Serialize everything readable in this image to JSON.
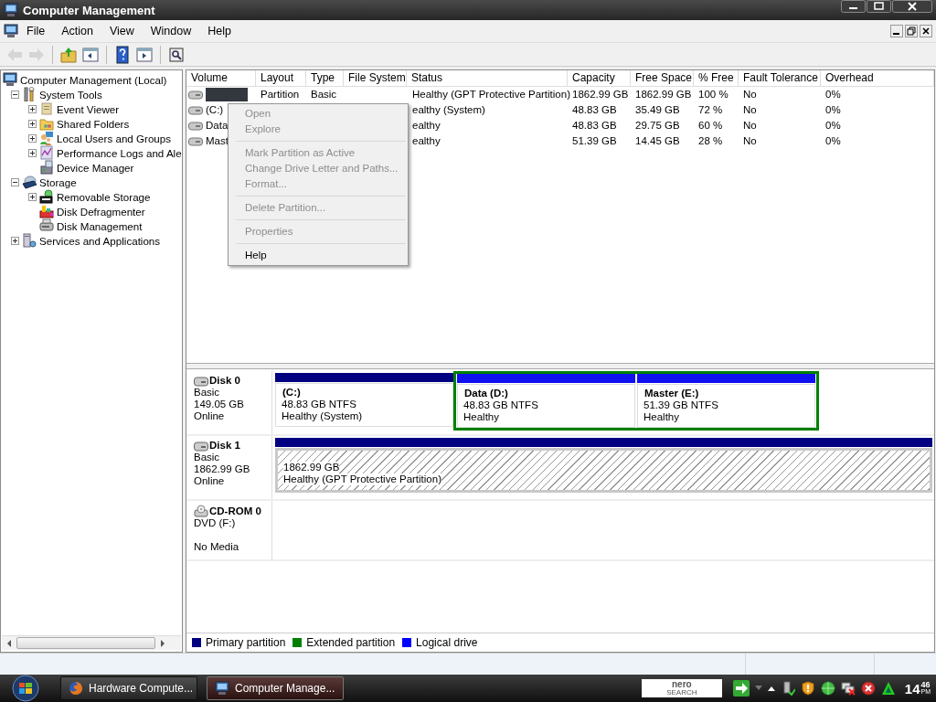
{
  "window": {
    "title": "Computer Management"
  },
  "menu": [
    "File",
    "Action",
    "View",
    "Window",
    "Help"
  ],
  "toolbar": [
    {
      "kind": "back",
      "disabled": true
    },
    {
      "kind": "forward",
      "disabled": true
    },
    {
      "kind": "sep"
    },
    {
      "kind": "up",
      "disabled": false
    },
    {
      "kind": "tree",
      "disabled": false
    },
    {
      "kind": "sep"
    },
    {
      "kind": "help",
      "disabled": false
    },
    {
      "kind": "pane",
      "disabled": false
    },
    {
      "kind": "sep"
    },
    {
      "kind": "props",
      "disabled": false
    }
  ],
  "tree": [
    {
      "label": "Computer Management (Local)",
      "children": [
        {
          "label": "System Tools",
          "expanded": true,
          "children": [
            {
              "label": "Event Viewer",
              "expanded": false
            },
            {
              "label": "Shared Folders",
              "expanded": false
            },
            {
              "label": "Local Users and Groups",
              "expanded": false
            },
            {
              "label": "Performance Logs and Ale",
              "expanded": false
            },
            {
              "label": "Device Manager"
            }
          ]
        },
        {
          "label": "Storage",
          "expanded": true,
          "children": [
            {
              "label": "Removable Storage",
              "expanded": false
            },
            {
              "label": "Disk Defragmenter"
            },
            {
              "label": "Disk Management"
            }
          ]
        },
        {
          "label": "Services and Applications",
          "expanded": false
        }
      ]
    }
  ],
  "table": {
    "columns": [
      "Volume",
      "Layout",
      "Type",
      "File System",
      "Status",
      "Capacity",
      "Free Space",
      "% Free",
      "Fault Tolerance",
      "Overhead"
    ],
    "rows": [
      {
        "selected": true,
        "cells": [
          "",
          "Partition",
          "Basic",
          "",
          "Healthy (GPT Protective Partition)",
          "1862.99 GB",
          "1862.99 GB",
          "100 %",
          "No",
          "0%"
        ]
      },
      {
        "selected": false,
        "cells": [
          "(C:)",
          "",
          "",
          "",
          "ealthy (System)",
          "48.83 GB",
          "35.49 GB",
          "72 %",
          "No",
          "0%"
        ]
      },
      {
        "selected": false,
        "cells": [
          "Data",
          "",
          "",
          "",
          "ealthy",
          "48.83 GB",
          "29.75 GB",
          "60 %",
          "No",
          "0%"
        ]
      },
      {
        "selected": false,
        "cells": [
          "Mast",
          "",
          "",
          "",
          "ealthy",
          "51.39 GB",
          "14.45 GB",
          "28 %",
          "No",
          "0%"
        ]
      }
    ]
  },
  "context_menu": [
    {
      "kind": "item",
      "label": "Open",
      "disabled": true
    },
    {
      "kind": "item",
      "label": "Explore",
      "disabled": true
    },
    {
      "kind": "separator"
    },
    {
      "kind": "item",
      "label": "Mark Partition as Active",
      "disabled": true
    },
    {
      "kind": "item",
      "label": "Change Drive Letter and Paths...",
      "disabled": true
    },
    {
      "kind": "item",
      "label": "Format...",
      "disabled": true
    },
    {
      "kind": "separator"
    },
    {
      "kind": "item",
      "label": "Delete Partition...",
      "disabled": true
    },
    {
      "kind": "separator"
    },
    {
      "kind": "item",
      "label": "Properties",
      "disabled": true
    },
    {
      "kind": "separator"
    },
    {
      "kind": "item",
      "label": "Help",
      "disabled": false
    }
  ],
  "disks": [
    {
      "kind": "disk",
      "name": "Disk 0",
      "info": [
        "Basic",
        "149.05 GB",
        "Online"
      ],
      "partitions": [
        {
          "kind": "primary",
          "title": "(C:)",
          "size": "48.83 GB NTFS",
          "status": "Healthy (System)"
        },
        {
          "kind": "extended",
          "children": [
            {
              "kind": "logical",
              "title": "Data  (D:)",
              "size": "48.83 GB NTFS",
              "status": "Healthy"
            },
            {
              "kind": "logical",
              "title": "Master  (E:)",
              "size": "51.39 GB NTFS",
              "status": "Healthy"
            }
          ]
        }
      ]
    },
    {
      "kind": "disk",
      "name": "Disk 1",
      "info": [
        "Basic",
        "1862.99 GB",
        "Online"
      ],
      "partitions": [
        {
          "kind": "primary",
          "hatched": true,
          "size": "1862.99 GB",
          "status": "Healthy (GPT Protective Partition)"
        }
      ]
    },
    {
      "kind": "cdrom",
      "name": "CD-ROM 0",
      "info": [
        "DVD (F:)"
      ],
      "note": "No Media"
    }
  ],
  "legend": [
    {
      "label": "Primary partition",
      "color": "#000080"
    },
    {
      "label": "Extended partition",
      "color": "#008000"
    },
    {
      "label": "Logical drive",
      "color": "#0000ff"
    }
  ],
  "taskbar": {
    "tasks": [
      {
        "label": "Hardware Compute...",
        "selected": false
      },
      {
        "label": "Computer Manage...",
        "selected": true
      }
    ],
    "search_logo": [
      "nero",
      "SEARCH"
    ],
    "clock": {
      "hour": "14",
      "minute": "46",
      "ampm": "PM"
    }
  }
}
